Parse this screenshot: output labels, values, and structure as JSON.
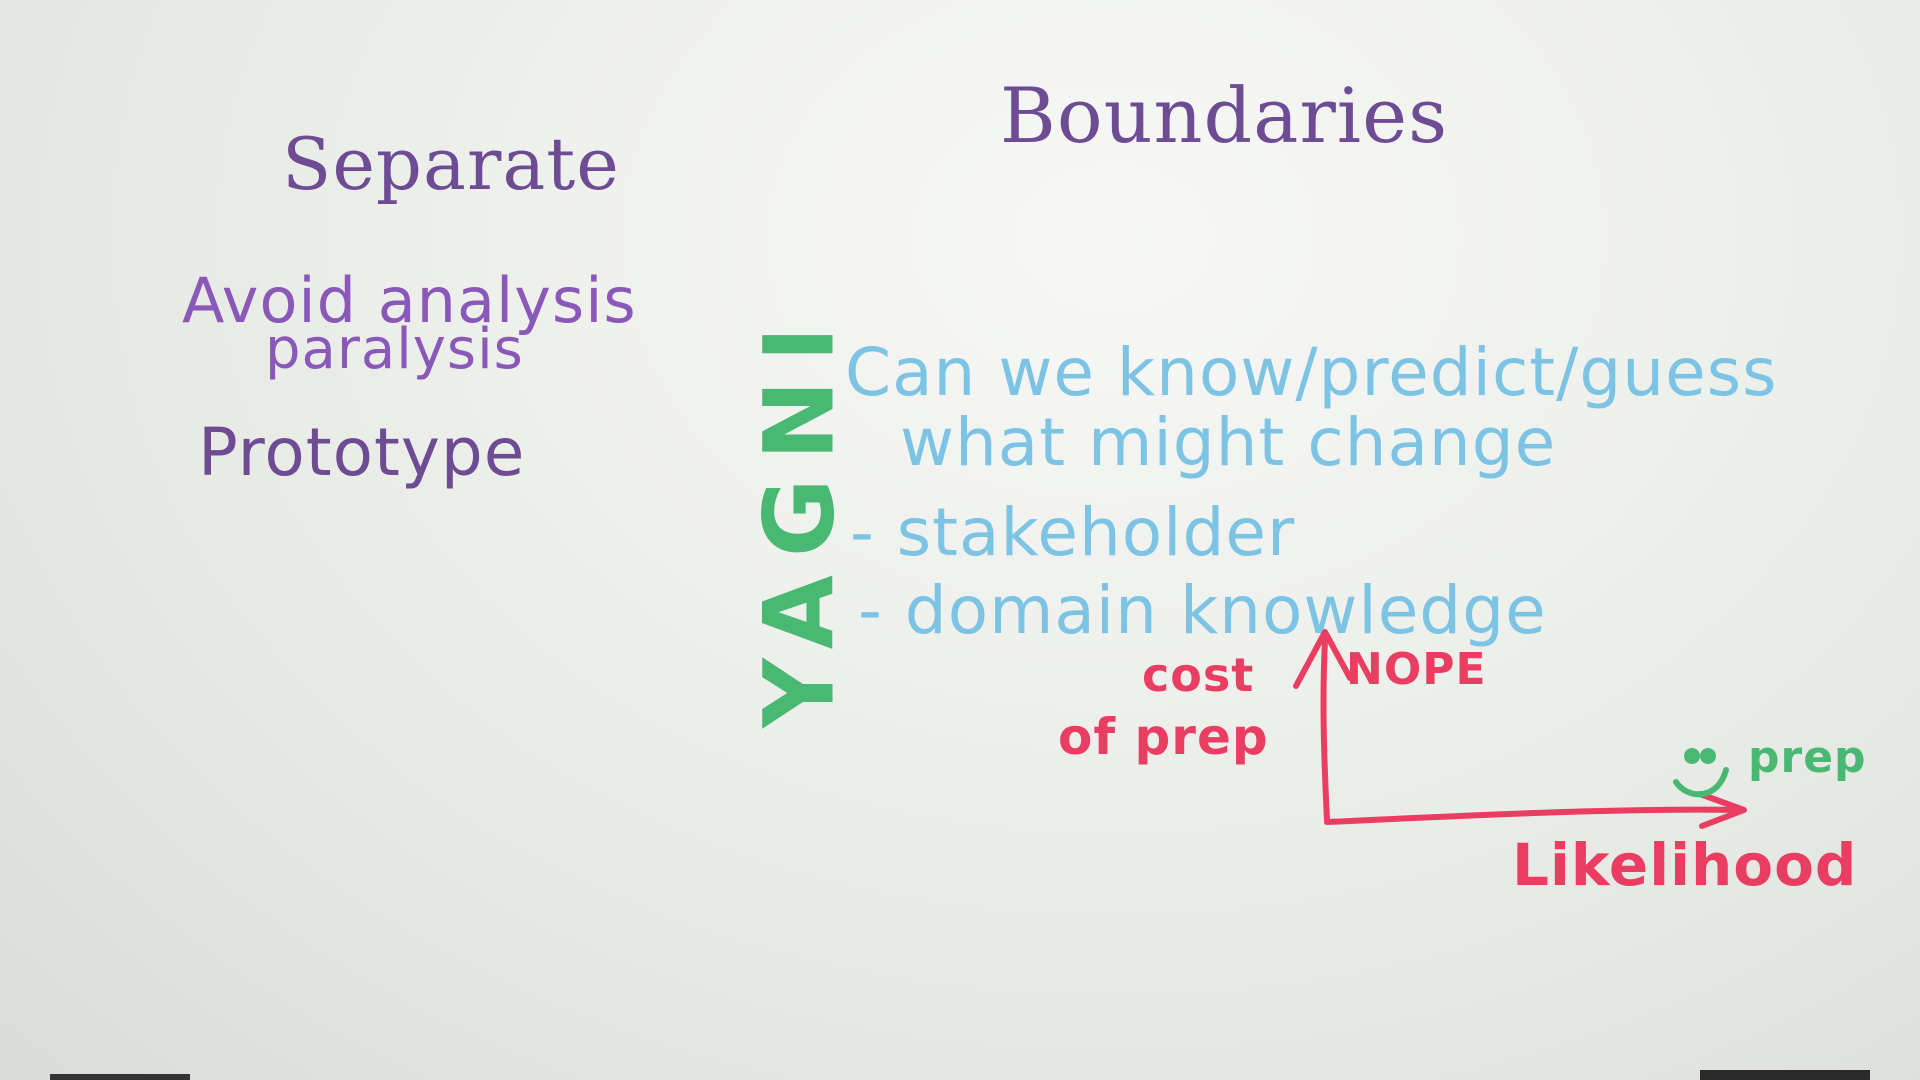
{
  "board": {
    "title": "Boundaries",
    "left_column": {
      "heading": "Separate",
      "avoid_line_1": "Avoid analysis",
      "avoid_line_2": "paralysis",
      "prototype": "Prototype"
    },
    "yagni": "YAGNI",
    "notes": {
      "line_1": "Can we know/predict/guess",
      "line_2": "what might change",
      "line_3": "- stakeholder",
      "line_4": "- domain knowledge"
    },
    "graph": {
      "y_label_line_1": "cost",
      "y_label_line_2": "of prep",
      "corner_label": "NOPE",
      "x_label": "Likelihood",
      "end_label": "prep"
    }
  },
  "colors": {
    "purple_ink": "#6e4c93",
    "blue_ink": "#7cc3e4",
    "green_ink": "#49b873",
    "red_ink": "#ea3d62",
    "board_background": "#eef0ec"
  },
  "icons": {
    "smiley": "smiley-face-icon",
    "axis_arrows": "arrow-icon"
  }
}
